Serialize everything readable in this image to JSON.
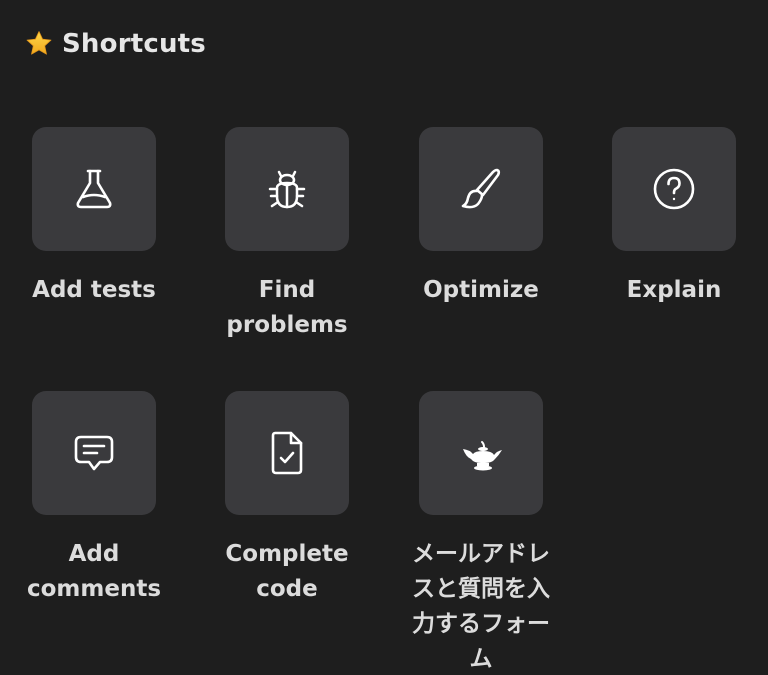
{
  "header": {
    "icon": "star-icon",
    "title": "Shortcuts"
  },
  "colors": {
    "background": "#1e1e1e",
    "tile": "#3a3a3d",
    "text": "#dcdcdc",
    "star": "#f5c02e"
  },
  "shortcuts": [
    {
      "label": "Add tests",
      "icon": "flask-icon"
    },
    {
      "label": "Find problems",
      "icon": "bug-icon"
    },
    {
      "label": "Optimize",
      "icon": "paintbrush-icon"
    },
    {
      "label": "Explain",
      "icon": "question-circle-icon"
    },
    {
      "label": "Add comments",
      "icon": "comment-icon"
    },
    {
      "label": "Complete code",
      "icon": "file-check-icon"
    },
    {
      "label": "メールアドレスと質問を入力するフォーム",
      "icon": "magic-lamp-icon"
    }
  ]
}
